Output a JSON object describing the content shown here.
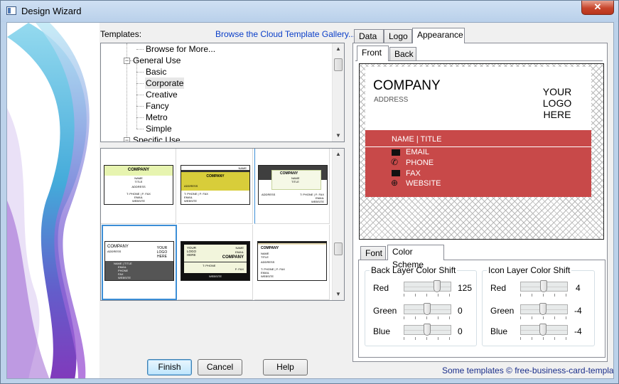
{
  "window": {
    "title": "Design Wizard",
    "close_glyph": "✕"
  },
  "templates": {
    "label": "Templates:",
    "gallery_link": "Browse the Cloud Template Gallery...",
    "tree": [
      "Browse for More...",
      "General Use",
      "Basic",
      "Corporate",
      "Creative",
      "Fancy",
      "Metro",
      "Simple",
      "Specific Use"
    ],
    "selected": "Corporate"
  },
  "thumbnails": [
    {
      "company": "COMPANY",
      "name": "NAME",
      "title": "TITLE",
      "address": "ADDRESS",
      "phone": "T: PHONE | F: FAX",
      "email": "EMAIL",
      "website": "WEBSITE"
    },
    {
      "company": "COMPANY",
      "name": "NAME",
      "title": "TITLE",
      "address": "ADDRESS",
      "phone": "T: PHONE | F: FAX",
      "email": "EMAIL",
      "website": "WEBSITE"
    },
    {
      "company": "COMPANY",
      "name": "NAME",
      "title": "TITLE",
      "address": "ADDRESS",
      "phone": "T: PHONE | F: FAX",
      "email": "EMAIL",
      "website": "WEBSITE"
    },
    {
      "company": "COMPANY",
      "address": "ADDRESS",
      "logo": "YOUR LOGO HERE",
      "name_title": "NAME | TITLE",
      "email": "EMAIL",
      "phone": "PHONE",
      "fax": "FAX",
      "website": "WEBSITE"
    },
    {
      "company": "COMPANY",
      "logo": "YOUR LOGO HERE",
      "name": "NAME",
      "email": "EMAIL",
      "phone": "T: PHONE",
      "fax": "F: FAX",
      "website": "WEBSITE"
    },
    {
      "company": "COMPANY",
      "name": "NAME",
      "title": "TITLE",
      "address": "ADDRESS",
      "phone": "T: PHONE | F: FAX",
      "email": "EMAIL",
      "website": "WEBSITE"
    }
  ],
  "buttons": {
    "finish": "Finish",
    "cancel": "Cancel",
    "help": "Help"
  },
  "credit": "Some templates © free-business-card-templates",
  "tabs": {
    "main": [
      "Data",
      "Logo",
      "Appearance"
    ],
    "side": [
      "Front",
      "Back"
    ],
    "settings": [
      "Font",
      "Color Scheme"
    ]
  },
  "card": {
    "company": "COMPANY",
    "address": "ADDRESS",
    "logo": [
      "YOUR",
      "LOGO",
      "HERE"
    ],
    "name_title": "NAME | TITLE",
    "email": "EMAIL",
    "phone": "PHONE",
    "fax": "FAX",
    "website": "WEBSITE"
  },
  "color_scheme": {
    "back_layer": {
      "title": "Back Layer Color Shift",
      "red_label": "Red",
      "red": "125",
      "green_label": "Green",
      "green": "0",
      "blue_label": "Blue",
      "blue": "0"
    },
    "icon_layer": {
      "title": "Icon Layer Color Shift",
      "red_label": "Red",
      "red": "4",
      "green_label": "Green",
      "green": "-4",
      "blue_label": "Blue",
      "blue": "-4"
    }
  },
  "colors": {
    "card_red": "#c84949",
    "accent_blue": "#3c8ed6",
    "link": "#0a3ec8"
  }
}
